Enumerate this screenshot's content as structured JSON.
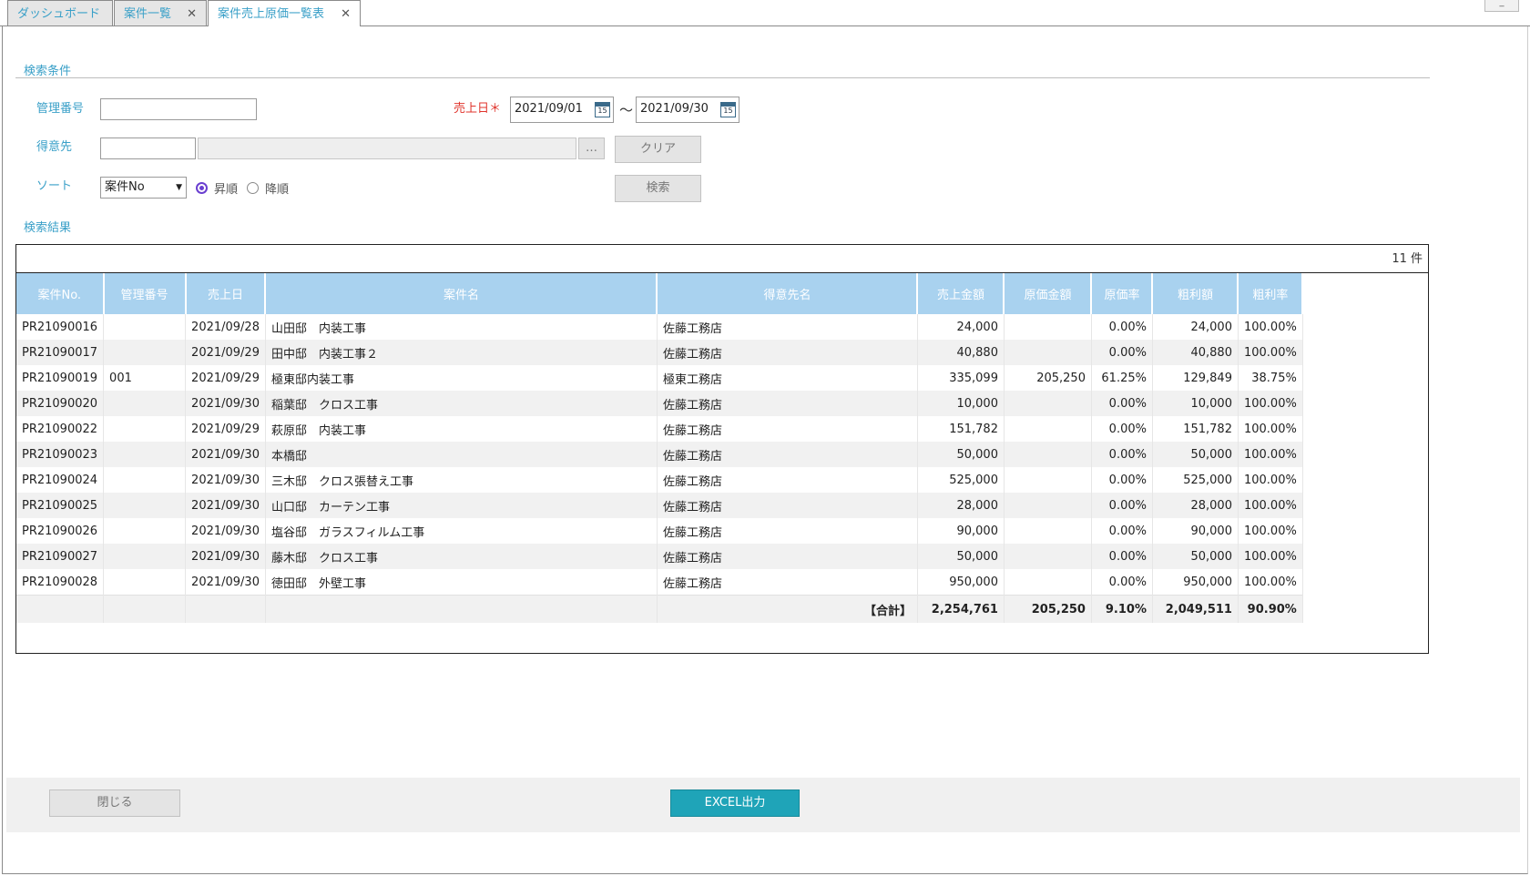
{
  "tabs": [
    {
      "label": "ダッシュボード",
      "closable": false
    },
    {
      "label": "案件一覧",
      "closable": true
    },
    {
      "label": "案件売上原価一覧表",
      "closable": true,
      "active": true
    }
  ],
  "window": {
    "minimize": "_"
  },
  "search": {
    "title": "検索条件",
    "kanri_label": "管理番号",
    "kanri_value": "",
    "uriagebi_label": "売上日＊",
    "date_from": "2021/09/01",
    "date_to": "2021/09/30",
    "date_sep": "〜",
    "calendar_text": "15",
    "tokuisaki_label": "得意先",
    "tokuisaki_code": "",
    "tokuisaki_name": "",
    "lookup_label": "…",
    "clear_label": "クリア",
    "sort_label": "ソート",
    "sort_value": "案件No",
    "asc_label": "昇順",
    "desc_label": "降順",
    "sort_order": "asc",
    "search_label": "検索"
  },
  "results": {
    "title": "検索結果",
    "count_text": "11 件",
    "columns": [
      "案件No.",
      "管理番号",
      "売上日",
      "案件名",
      "得意先名",
      "売上金額",
      "原価金額",
      "原価率",
      "粗利額",
      "粗利率"
    ],
    "rows": [
      [
        "PR21090016",
        "",
        "2021/09/28",
        "山田邸　内装工事",
        "佐藤工務店",
        "24,000",
        "",
        "0.00%",
        "24,000",
        "100.00%"
      ],
      [
        "PR21090017",
        "",
        "2021/09/29",
        "田中邸　内装工事２",
        "佐藤工務店",
        "40,880",
        "",
        "0.00%",
        "40,880",
        "100.00%"
      ],
      [
        "PR21090019",
        "001",
        "2021/09/29",
        "極東邸内装工事",
        "極東工務店",
        "335,099",
        "205,250",
        "61.25%",
        "129,849",
        "38.75%"
      ],
      [
        "PR21090020",
        "",
        "2021/09/30",
        "稲葉邸　クロス工事",
        "佐藤工務店",
        "10,000",
        "",
        "0.00%",
        "10,000",
        "100.00%"
      ],
      [
        "PR21090022",
        "",
        "2021/09/29",
        "萩原邸　内装工事",
        "佐藤工務店",
        "151,782",
        "",
        "0.00%",
        "151,782",
        "100.00%"
      ],
      [
        "PR21090023",
        "",
        "2021/09/30",
        "本橋邸",
        "佐藤工務店",
        "50,000",
        "",
        "0.00%",
        "50,000",
        "100.00%"
      ],
      [
        "PR21090024",
        "",
        "2021/09/30",
        "三木邸　クロス張替え工事",
        "佐藤工務店",
        "525,000",
        "",
        "0.00%",
        "525,000",
        "100.00%"
      ],
      [
        "PR21090025",
        "",
        "2021/09/30",
        "山口邸　カーテン工事",
        "佐藤工務店",
        "28,000",
        "",
        "0.00%",
        "28,000",
        "100.00%"
      ],
      [
        "PR21090026",
        "",
        "2021/09/30",
        "塩谷邸　ガラスフィルム工事",
        "佐藤工務店",
        "90,000",
        "",
        "0.00%",
        "90,000",
        "100.00%"
      ],
      [
        "PR21090027",
        "",
        "2021/09/30",
        "藤木邸　クロス工事",
        "佐藤工務店",
        "50,000",
        "",
        "0.00%",
        "50,000",
        "100.00%"
      ],
      [
        "PR21090028",
        "",
        "2021/09/30",
        "徳田邸　外壁工事",
        "佐藤工務店",
        "950,000",
        "",
        "0.00%",
        "950,000",
        "100.00%"
      ]
    ],
    "total": {
      "label": "【合計】",
      "uriage": "2,254,761",
      "genka": "205,250",
      "genka_rate": "9.10%",
      "arari": "2,049,511",
      "arari_rate": "90.90%"
    }
  },
  "footer": {
    "close_label": "閉じる",
    "excel_label": "EXCEL出力"
  },
  "colors": {
    "accent": "#3aa0c8",
    "header_bg": "#a9d2ef",
    "required": "#e0342c",
    "primary_btn": "#1fa4b8",
    "radio": "#6a3fd0"
  }
}
